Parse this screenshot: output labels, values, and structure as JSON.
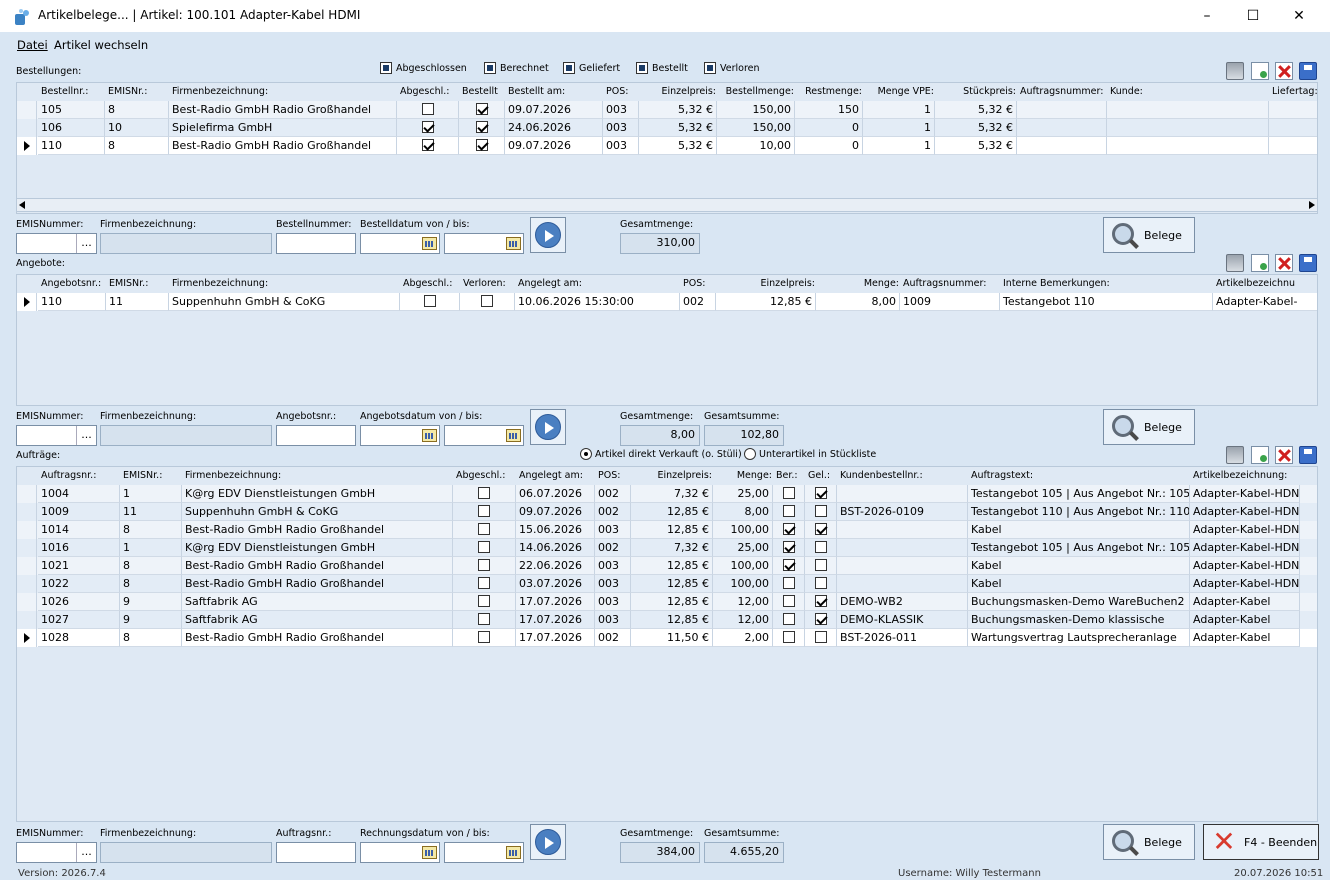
{
  "window": {
    "title": "Artikelbelege... | Artikel: 100.101 Adapter-Kabel HDMI",
    "minimize": "–",
    "maximize": "☐",
    "close": "✕"
  },
  "menu": {
    "datei": "Datei",
    "artikel_wechseln": "Artikel wechseln"
  },
  "bestellungen": {
    "label": "Bestellungen:",
    "filters": [
      "Abgeschlossen",
      "Berechnet",
      "Geliefert",
      "Bestellt",
      "Verloren"
    ],
    "columns": [
      "Bestellnr.:",
      "EMISNr.:",
      "Firmenbezeichnung:",
      "Abgeschl.:",
      "Bestellt",
      "Bestellt am:",
      "POS:",
      "Einzelpreis:",
      "Bestellmenge:",
      "Restmenge:",
      "Menge VPE:",
      "Stückpreis:",
      "Auftragsnummer:",
      "Kunde:",
      "Liefertag:"
    ],
    "rows": [
      {
        "nr": "105",
        "emis": "8",
        "firma": "Best-Radio GmbH Radio Großhandel",
        "abg": false,
        "best": true,
        "datum": "09.07.2026",
        "pos": "003",
        "preis": "5,32 €",
        "menge": "150,00",
        "rest": "150",
        "vpe": "1",
        "stueck": "5,32 €",
        "auftrag": "",
        "kunde": "",
        "liefer": ""
      },
      {
        "nr": "106",
        "emis": "10",
        "firma": "Spielefirma GmbH",
        "abg": true,
        "best": true,
        "datum": "24.06.2026",
        "pos": "003",
        "preis": "5,32 €",
        "menge": "150,00",
        "rest": "0",
        "vpe": "1",
        "stueck": "5,32 €",
        "auftrag": "",
        "kunde": "",
        "liefer": ""
      },
      {
        "nr": "110",
        "emis": "8",
        "firma": "Best-Radio GmbH Radio Großhandel",
        "abg": true,
        "best": true,
        "datum": "09.07.2026",
        "pos": "003",
        "preis": "5,32 €",
        "menge": "10,00",
        "rest": "0",
        "vpe": "1",
        "stueck": "5,32 €",
        "auftrag": "",
        "kunde": "",
        "liefer": ""
      }
    ],
    "filter_labels": {
      "emis": "EMISNummer:",
      "firma": "Firmenbezeichnung:",
      "nr": "Bestellnummer:",
      "datum": "Bestelldatum von / bis:",
      "gesamtmenge": "Gesamtmenge:"
    },
    "gesamtmenge": "310,00",
    "belege": "Belege"
  },
  "angebote": {
    "label": "Angebote:",
    "columns": [
      "Angebotsnr.:",
      "EMISNr.:",
      "Firmenbezeichnung:",
      "Abgeschl.:",
      "Verloren:",
      "Angelegt am:",
      "POS:",
      "Einzelpreis:",
      "Menge:",
      "Auftragsnummer:",
      "Interne Bemerkungen:",
      "Artikelbezeichnu"
    ],
    "rows": [
      {
        "nr": "110",
        "emis": "11",
        "firma": "Suppenhuhn GmbH & CoKG",
        "abg": false,
        "verl": false,
        "datum": "10.06.2026 15:30:00",
        "pos": "002",
        "preis": "12,85 €",
        "menge": "8,00",
        "auftrag": "1009",
        "bem": "Testangebot 110",
        "artikel": "Adapter-Kabel-"
      }
    ],
    "filter_labels": {
      "emis": "EMISNummer:",
      "firma": "Firmenbezeichnung:",
      "nr": "Angebotsnr.:",
      "datum": "Angebotsdatum von / bis:",
      "gesamtmenge": "Gesamtmenge:",
      "gesamtsumme": "Gesamtsumme:"
    },
    "gesamtmenge": "8,00",
    "gesamtsumme": "102,80",
    "belege": "Belege"
  },
  "auftraege": {
    "label": "Aufträge:",
    "radio1": "Artikel direkt Verkauft (o. Stüli)",
    "radio2": "Unterartikel in Stückliste",
    "columns": [
      "Auftragsnr.:",
      "EMISNr.:",
      "Firmenbezeichnung:",
      "Abgeschl.:",
      "Angelegt am:",
      "POS:",
      "Einzelpreis:",
      "Menge:",
      "Ber.:",
      "Gel.:",
      "Kundenbestellnr.:",
      "Auftragstext:",
      "Artikelbezeichnung:"
    ],
    "rows": [
      {
        "nr": "1004",
        "emis": "1",
        "firma": "K@rg EDV Dienstleistungen GmbH",
        "abg": false,
        "datum": "06.07.2026",
        "pos": "002",
        "preis": "7,32 €",
        "menge": "25,00",
        "ber": false,
        "gel": true,
        "kbnr": "",
        "text": "Testangebot 105 | Aus Angebot Nr.: 105",
        "artikel": "Adapter-Kabel-HDN"
      },
      {
        "nr": "1009",
        "emis": "11",
        "firma": "Suppenhuhn GmbH & CoKG",
        "abg": false,
        "datum": "09.07.2026",
        "pos": "002",
        "preis": "12,85 €",
        "menge": "8,00",
        "ber": false,
        "gel": false,
        "kbnr": "BST-2026-0109",
        "text": "Testangebot 110 | Aus Angebot Nr.: 110",
        "artikel": "Adapter-Kabel-HDN"
      },
      {
        "nr": "1014",
        "emis": "8",
        "firma": "Best-Radio GmbH Radio Großhandel",
        "abg": false,
        "datum": "15.06.2026",
        "pos": "003",
        "preis": "12,85 €",
        "menge": "100,00",
        "ber": true,
        "gel": true,
        "kbnr": "",
        "text": "Kabel",
        "artikel": "Adapter-Kabel-HDN"
      },
      {
        "nr": "1016",
        "emis": "1",
        "firma": "K@rg EDV Dienstleistungen GmbH",
        "abg": false,
        "datum": "14.06.2026",
        "pos": "002",
        "preis": "7,32 €",
        "menge": "25,00",
        "ber": true,
        "gel": false,
        "kbnr": "",
        "text": "Testangebot 105 | Aus Angebot Nr.: 105",
        "artikel": "Adapter-Kabel-HDN"
      },
      {
        "nr": "1021",
        "emis": "8",
        "firma": "Best-Radio GmbH Radio Großhandel",
        "abg": false,
        "datum": "22.06.2026",
        "pos": "003",
        "preis": "12,85 €",
        "menge": "100,00",
        "ber": true,
        "gel": false,
        "kbnr": "",
        "text": "Kabel",
        "artikel": "Adapter-Kabel-HDN"
      },
      {
        "nr": "1022",
        "emis": "8",
        "firma": "Best-Radio GmbH Radio Großhandel",
        "abg": false,
        "datum": "03.07.2026",
        "pos": "003",
        "preis": "12,85 €",
        "menge": "100,00",
        "ber": false,
        "gel": false,
        "kbnr": "",
        "text": "Kabel",
        "artikel": "Adapter-Kabel-HDN"
      },
      {
        "nr": "1026",
        "emis": "9",
        "firma": "Saftfabrik AG",
        "abg": false,
        "datum": "17.07.2026",
        "pos": "003",
        "preis": "12,85 €",
        "menge": "12,00",
        "ber": false,
        "gel": true,
        "kbnr": "DEMO-WB2",
        "text": "Buchungsmasken-Demo WareBuchen2",
        "artikel": "Adapter-Kabel"
      },
      {
        "nr": "1027",
        "emis": "9",
        "firma": "Saftfabrik AG",
        "abg": false,
        "datum": "17.07.2026",
        "pos": "003",
        "preis": "12,85 €",
        "menge": "12,00",
        "ber": false,
        "gel": true,
        "kbnr": "DEMO-KLASSIK",
        "text": "Buchungsmasken-Demo klassische",
        "artikel": "Adapter-Kabel"
      },
      {
        "nr": "1028",
        "emis": "8",
        "firma": "Best-Radio GmbH Radio Großhandel",
        "abg": false,
        "datum": "17.07.2026",
        "pos": "002",
        "preis": "11,50 €",
        "menge": "2,00",
        "ber": false,
        "gel": false,
        "kbnr": "BST-2026-011",
        "text": "Wartungsvertrag Lautsprecheranlage",
        "artikel": "Adapter-Kabel"
      }
    ],
    "filter_labels": {
      "emis": "EMISNummer:",
      "firma": "Firmenbezeichnung:",
      "nr": "Auftragsnr.:",
      "datum": "Rechnungsdatum von / bis:",
      "gesamtmenge": "Gesamtmenge:",
      "gesamtsumme": "Gesamtsumme:"
    },
    "gesamtmenge": "384,00",
    "gesamtsumme": "4.655,20",
    "belege": "Belege",
    "beenden": "F4 - Beenden"
  },
  "status": {
    "version": "Version: 2026.7.4",
    "user": "Username: Willy Testermann",
    "datetime": "20.07.2026 10:51"
  }
}
